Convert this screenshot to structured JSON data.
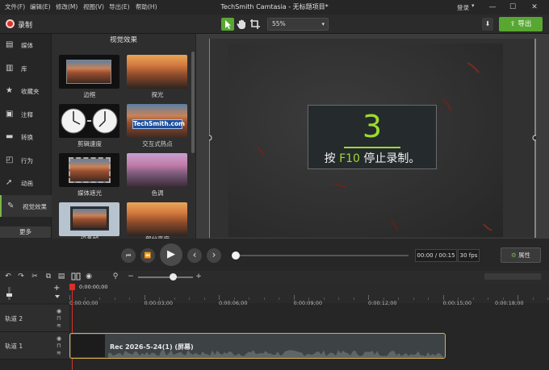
{
  "titlebar": {
    "menus": [
      "文件(F)",
      "编辑(E)",
      "修改(M)",
      "视图(V)",
      "导出(E)",
      "帮助(H)"
    ],
    "title": "TechSmith Camtasia - 无标题项目*",
    "login": "登录",
    "login_arrow": "▾",
    "minimize": "—",
    "maximize": "☐",
    "close": "✕"
  },
  "toolbar": {
    "record_label": "录制",
    "zoom_value": "55%",
    "export_label": "导出",
    "download_glyph": "⬇",
    "icons": [
      "arrow-pointer-icon",
      "hand-pan-icon",
      "crop-icon"
    ]
  },
  "sidebar": {
    "items": [
      {
        "label": "媒体",
        "icon": "film-strip-icon",
        "glyph": "▤"
      },
      {
        "label": "库",
        "icon": "library-icon",
        "glyph": "▥"
      },
      {
        "label": "收藏夹",
        "icon": "star-icon",
        "glyph": "★"
      },
      {
        "label": "注释",
        "icon": "annotation-icon",
        "glyph": "▣"
      },
      {
        "label": "转换",
        "icon": "transition-icon",
        "glyph": "▬"
      },
      {
        "label": "行为",
        "icon": "behavior-icon",
        "glyph": "◰"
      },
      {
        "label": "动画",
        "icon": "animation-icon",
        "glyph": "➚"
      },
      {
        "label": "视觉效果",
        "icon": "magic-wand-icon",
        "glyph": "✎"
      }
    ],
    "more_label": "更多"
  },
  "effects_panel": {
    "title": "视觉效果",
    "items": [
      "边框",
      "探光",
      "剪辑速度",
      "交互式热点",
      "媒体遮光",
      "色调",
      "设备帧",
      "部分亮度"
    ],
    "hotspot_badge": "TechSmith.com"
  },
  "canvas": {
    "countdown_number": "3",
    "message_prefix": "按",
    "message_key": "F10",
    "message_suffix": "停止录制。"
  },
  "playback": {
    "timecode": "00:00 / 00:15",
    "fps": "30 fps",
    "properties_label": "属性",
    "progress": 0,
    "glyphs": {
      "prev": "⏮",
      "step_back": "⏪",
      "play": "▶",
      "back": "‹",
      "forward": "›"
    }
  },
  "timeline_toolbar": {
    "zoom_minus": "−",
    "zoom_plus": "+",
    "zoom_level": 0.6,
    "glyphs": {
      "undo": "↶",
      "redo": "↷",
      "cut": "✂",
      "copy": "⧉",
      "paste": "▤",
      "snapshot": "◉",
      "search": "⚲"
    }
  },
  "timeline": {
    "playhead_time": "0:00:00;00",
    "ruler_ticks": [
      "0:00:00;00",
      "0:00:03;00",
      "0:00:06;00",
      "0:00:09;00",
      "0:00:12;00",
      "0:00:15;00",
      "0:00:18;00"
    ],
    "add_track": "+",
    "tracks": [
      {
        "name": "轨道 2"
      },
      {
        "name": "轨道 1"
      }
    ],
    "clip_title": "Rec 2026-5-24(1) (屏幕)"
  },
  "colors": {
    "accent_green": "#58a732",
    "countdown_green": "#9bdc2d",
    "record_red": "#e0302a",
    "clip_border": "#d9b24a"
  }
}
